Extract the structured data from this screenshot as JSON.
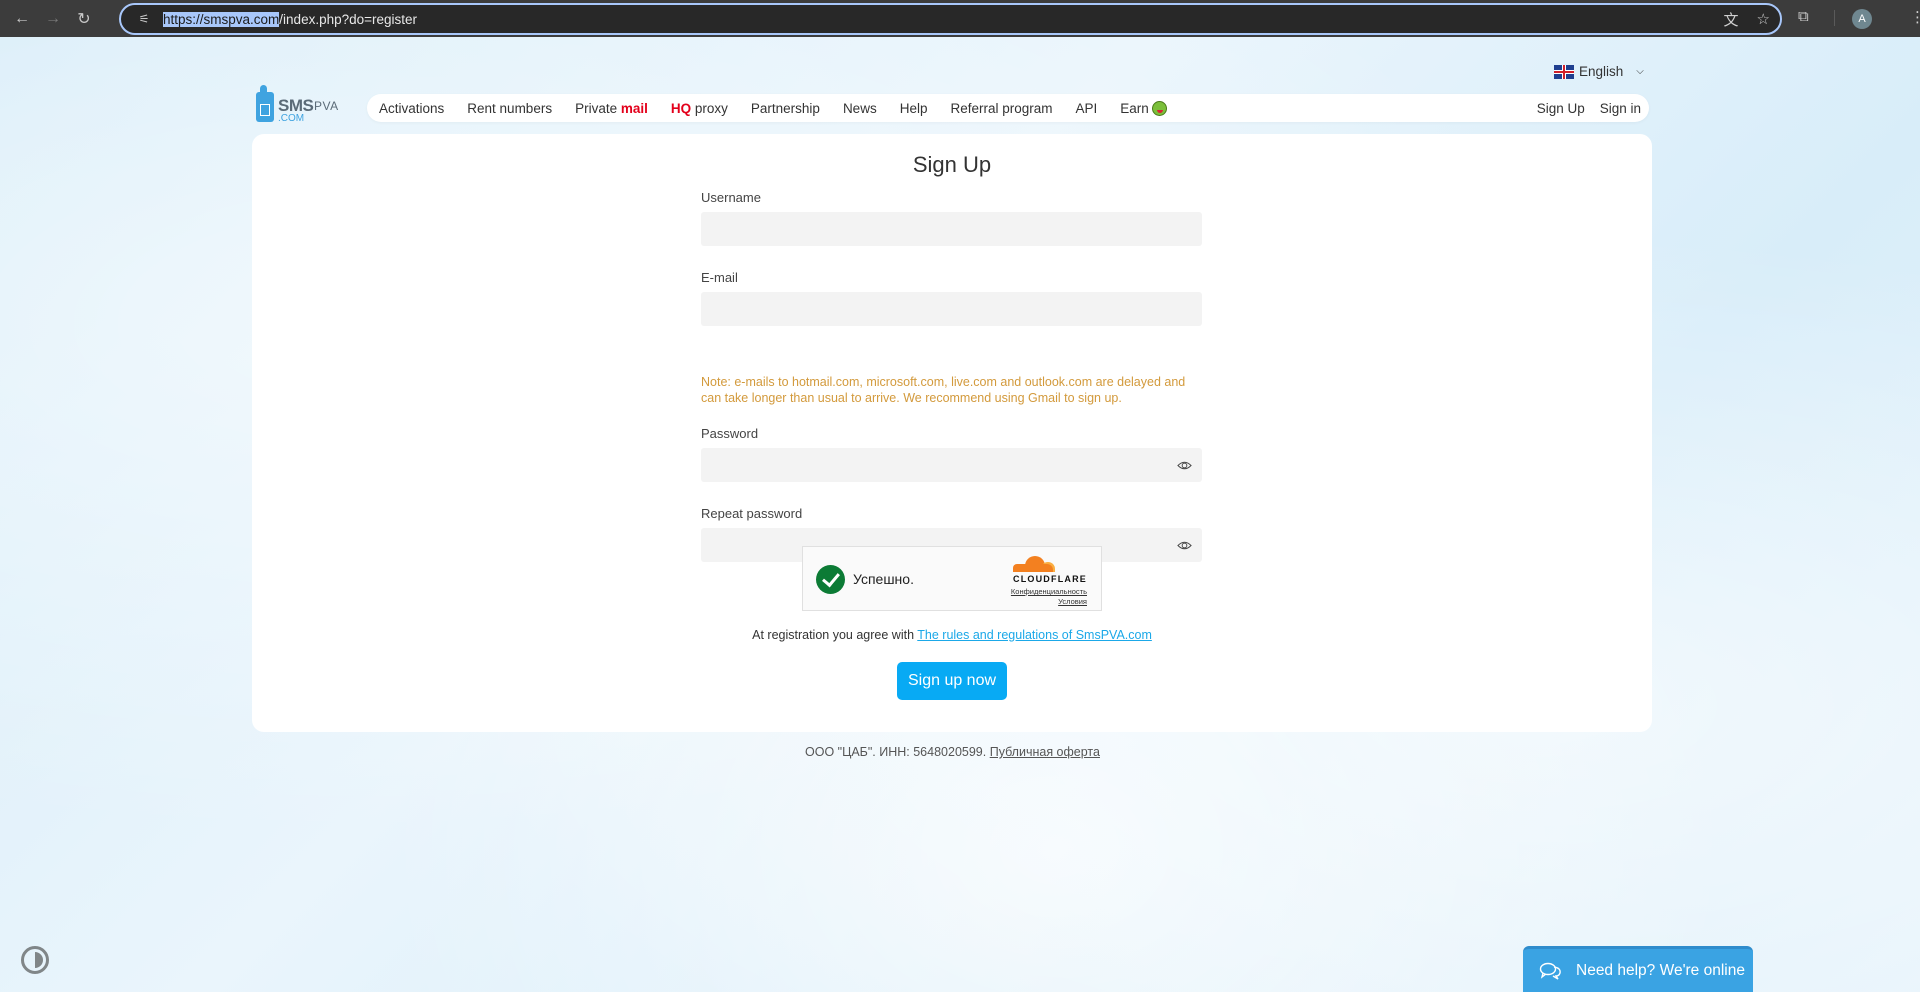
{
  "browser": {
    "url_selected": "https://smspva.com",
    "url_rest": "/index.php?do=register",
    "profile_initial": "A",
    "icons": {
      "back": "←",
      "forward": "→",
      "reload": "↻",
      "site_settings": "⚟",
      "translate": "文",
      "bookmark": "☆",
      "extensions": "⧉",
      "menu": "⋮"
    }
  },
  "header": {
    "language": "English",
    "logo": {
      "sms": "SMS",
      "pva": "PVA",
      "com": ".COM"
    },
    "nav": [
      {
        "label": "Activations"
      },
      {
        "label": "Rent numbers"
      },
      {
        "label": "Private ",
        "accent": "mail"
      },
      {
        "accent_prefix": "HQ",
        "label": " proxy"
      },
      {
        "label": "Partnership"
      },
      {
        "label": "News"
      },
      {
        "label": "Help"
      },
      {
        "label": "Referral program"
      },
      {
        "label": "API"
      },
      {
        "label": "Earn"
      }
    ],
    "auth": {
      "signup": "Sign Up",
      "signin": "Sign in"
    },
    "accent_color": "#e3001b"
  },
  "form": {
    "title": "Sign Up",
    "fields": {
      "username": {
        "label": "Username",
        "value": ""
      },
      "email": {
        "label": "E-mail",
        "value": ""
      },
      "password": {
        "label": "Password",
        "value": ""
      },
      "repeat_password": {
        "label": "Repeat password",
        "value": ""
      }
    },
    "note": "Note: e-mails to hotmail.com, microsoft.com, live.com and outlook.com are delayed and can take longer than usual to arrive. We recommend using Gmail to sign up.",
    "captcha": {
      "status": "Успешно.",
      "provider": "CLOUDFLARE",
      "privacy_link": "Конфиденциальность",
      "terms_link": "Условия"
    },
    "agree_text": "At registration you agree with ",
    "agree_link": "The rules and regulations of SmsPVA.com",
    "submit": "Sign up now",
    "button_color": "#08aaf4"
  },
  "footer": {
    "text": "ООО \"ЦАБ\". ИНН: 5648020599. ",
    "link": "Публичная оферта"
  },
  "chat_widget": {
    "label": "Need help? We're online"
  }
}
